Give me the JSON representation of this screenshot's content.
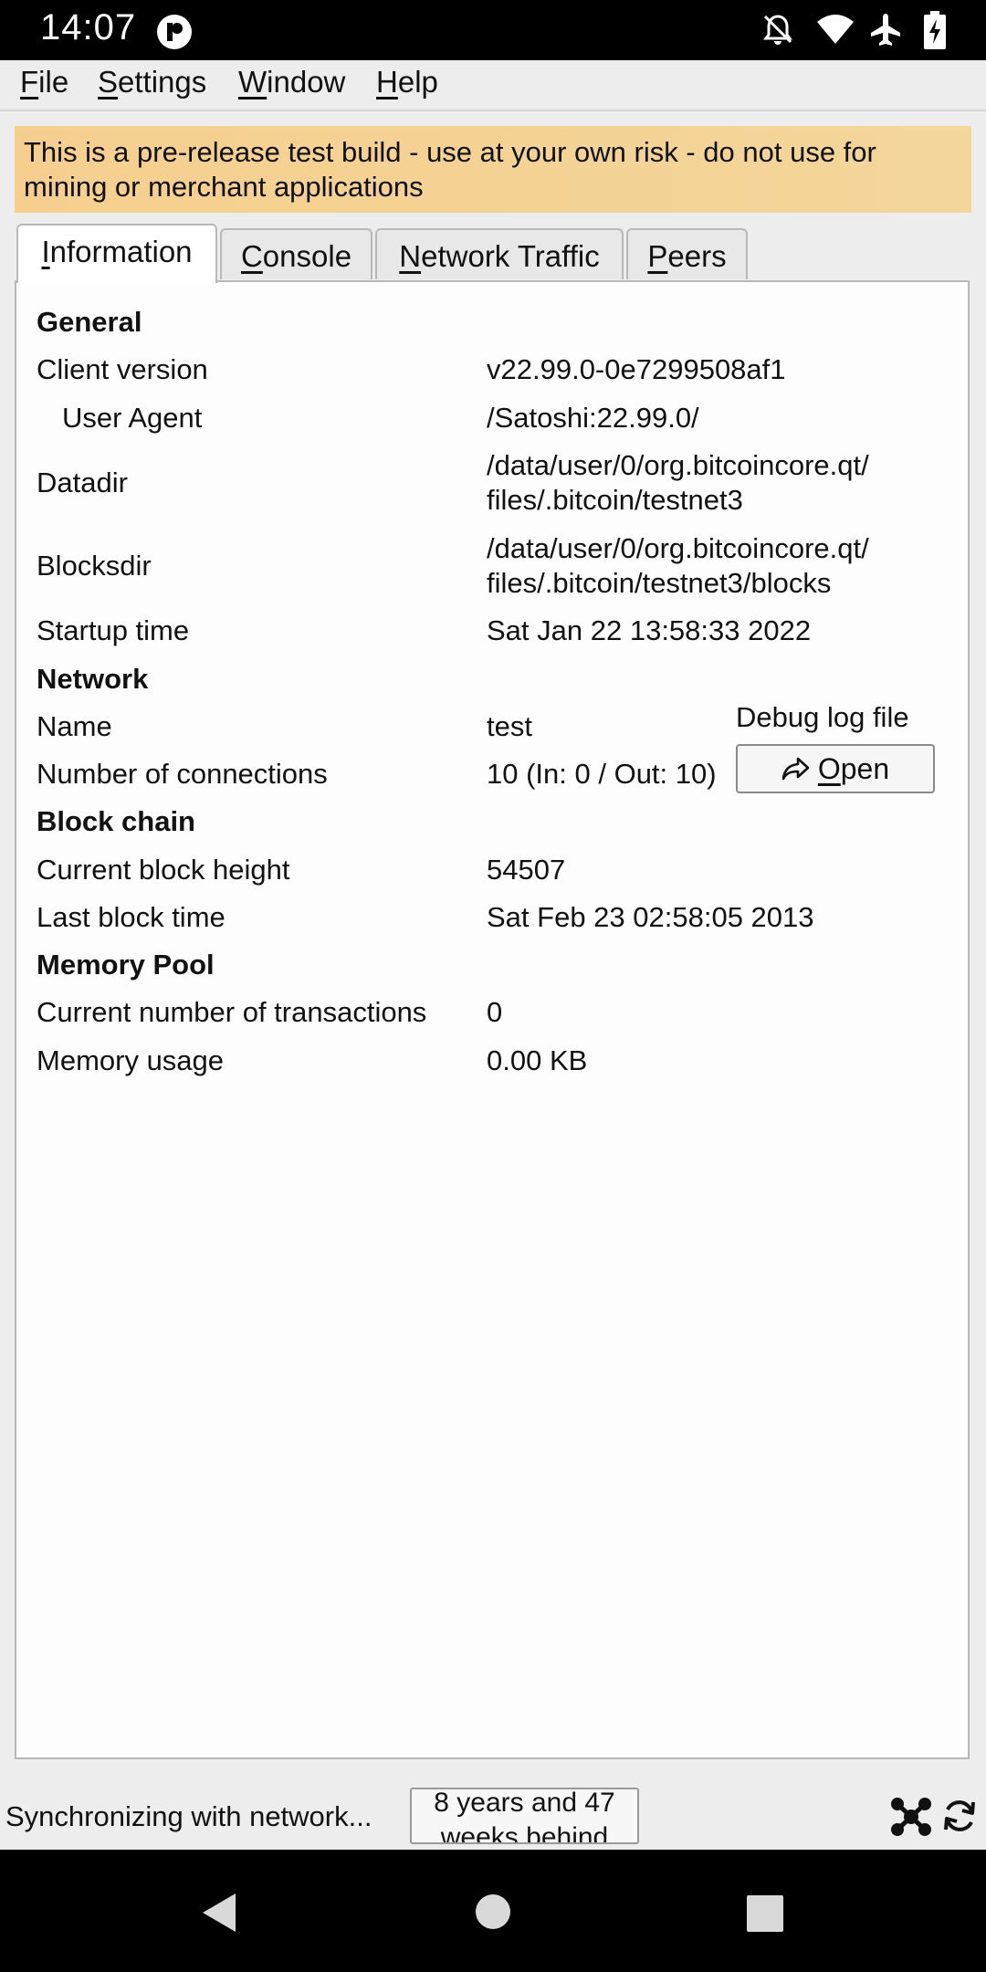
{
  "status_bar": {
    "time": "14:07",
    "icons": [
      "app-notification-icon",
      "bell-off-icon",
      "wifi-icon",
      "airplane-icon",
      "battery-charging-icon"
    ]
  },
  "menu": {
    "file_rest": "ile",
    "file_key": "F",
    "settings_key": "S",
    "settings_rest": "ettings",
    "window_key": "W",
    "window_rest": "indow",
    "help_key": "H",
    "help_rest": "elp"
  },
  "warning": "This is a pre-release test build - use at your own risk - do not use for mining or merchant applications",
  "tabs": {
    "information_key": "I",
    "information_rest": "nformation",
    "console_key": "C",
    "console_rest": "onsole",
    "traffic_key": "N",
    "traffic_rest": "etwork Traffic",
    "peers_key": "P",
    "peers_rest": "eers"
  },
  "info": {
    "general": "General",
    "client_version_label": "Client version",
    "client_version": "v22.99.0-0e7299508af1",
    "user_agent_label": "User Agent",
    "user_agent": "/Satoshi:22.99.0/",
    "datadir_label": "Datadir",
    "datadir_1": "/data/user/0/org.bitcoincore.qt/",
    "datadir_2": "files/.bitcoin/testnet3",
    "blocksdir_label": "Blocksdir",
    "blocksdir_1": "/data/user/0/org.bitcoincore.qt/",
    "blocksdir_2": "files/.bitcoin/testnet3/blocks",
    "startup_label": "Startup time",
    "startup": "Sat Jan 22 13:58:33 2022",
    "network": "Network",
    "name_label": "Name",
    "name": "test",
    "connections_label": "Number of connections",
    "connections": "10 (In: 0 / Out: 10)",
    "blockchain": "Block chain",
    "height_label": "Current block height",
    "height": "54507",
    "last_block_label": "Last block time",
    "last_block": "Sat Feb 23 02:58:05 2013",
    "mempool": "Memory Pool",
    "tx_label": "Current number of transactions",
    "tx": "0",
    "mem_label": "Memory usage",
    "mem": "0.00 KB",
    "debug_label": "Debug log file",
    "open_key": "O",
    "open_rest": "pen"
  },
  "footer": {
    "sync": "Synchronizing with network...",
    "behind_1": "8 years and 47",
    "behind_2": "weeks behind"
  },
  "nav": [
    "back-icon",
    "home-icon",
    "recents-icon"
  ]
}
